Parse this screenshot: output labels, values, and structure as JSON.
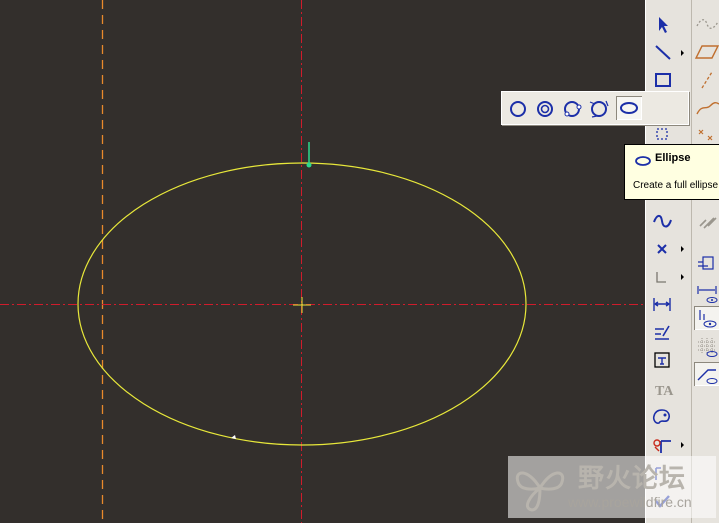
{
  "canvas": {
    "background": "#332f2c",
    "ellipse_color": "#e8e83a",
    "centerline_color": "#d01c2c",
    "reference_line_color": "#e88a2c",
    "handle_color": "#2cd88c"
  },
  "toolbar_main": {
    "tools": [
      {
        "name": "select",
        "icon": "arrow-pointer-icon"
      },
      {
        "name": "line",
        "icon": "line-icon"
      },
      {
        "name": "rectangle",
        "icon": "rectangle-icon"
      },
      {
        "name": "ellipse",
        "icon": "ellipse-icon"
      },
      {
        "name": "fillet",
        "icon": "fillet-icon"
      },
      {
        "name": "spline",
        "icon": "spline-icon"
      },
      {
        "name": "point",
        "icon": "point-icon"
      },
      {
        "name": "coordinate-system",
        "icon": "coordinate-system-icon"
      },
      {
        "name": "dimension",
        "icon": "dimension-icon"
      },
      {
        "name": "modify",
        "icon": "modify-icon"
      },
      {
        "name": "constraints",
        "icon": "constraints-icon"
      },
      {
        "name": "text",
        "icon": "text-icon"
      },
      {
        "name": "palette",
        "icon": "palette-icon"
      },
      {
        "name": "trim",
        "icon": "trim-icon"
      },
      {
        "name": "mirror",
        "icon": "mirror-icon"
      },
      {
        "name": "done",
        "icon": "checkmark-icon"
      }
    ]
  },
  "flyout": {
    "buttons": [
      {
        "name": "circle",
        "icon": "circle-icon"
      },
      {
        "name": "concentric-circle",
        "icon": "concentric-circle-icon"
      },
      {
        "name": "three-point-circle",
        "icon": "three-point-circle-icon"
      },
      {
        "name": "tangent-circle",
        "icon": "tangent-circle-icon"
      },
      {
        "name": "ellipse",
        "icon": "ellipse-icon"
      }
    ]
  },
  "tooltip": {
    "title": "Ellipse",
    "description": "Create a full ellipse"
  },
  "watermark": {
    "chinese": "野火论坛",
    "url": "www.proewildfire.cn"
  }
}
